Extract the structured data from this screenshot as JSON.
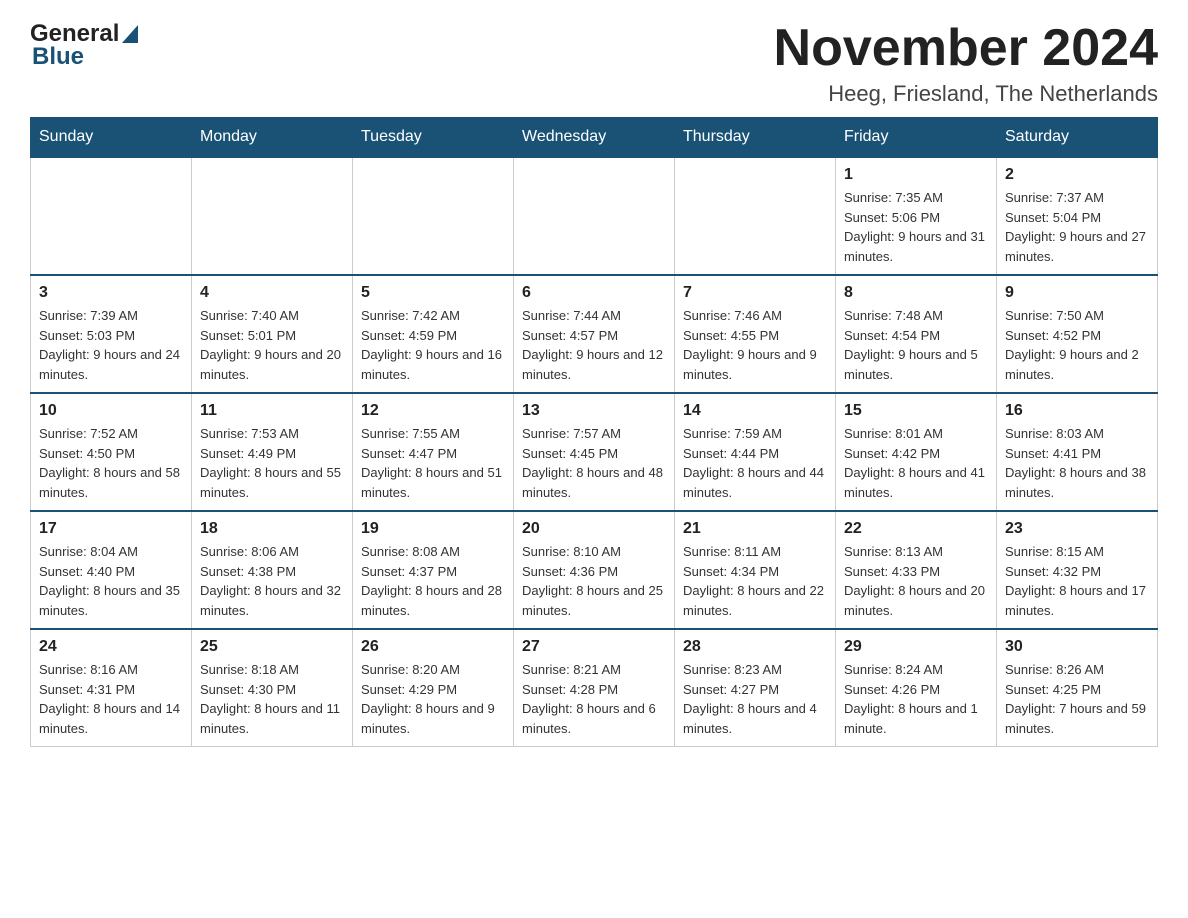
{
  "header": {
    "logo": {
      "part1": "General",
      "part2": "Blue"
    },
    "title": "November 2024",
    "subtitle": "Heeg, Friesland, The Netherlands"
  },
  "days_of_week": [
    "Sunday",
    "Monday",
    "Tuesday",
    "Wednesday",
    "Thursday",
    "Friday",
    "Saturday"
  ],
  "weeks": [
    {
      "days": [
        {
          "number": "",
          "info": ""
        },
        {
          "number": "",
          "info": ""
        },
        {
          "number": "",
          "info": ""
        },
        {
          "number": "",
          "info": ""
        },
        {
          "number": "",
          "info": ""
        },
        {
          "number": "1",
          "info": "Sunrise: 7:35 AM\nSunset: 5:06 PM\nDaylight: 9 hours and 31 minutes."
        },
        {
          "number": "2",
          "info": "Sunrise: 7:37 AM\nSunset: 5:04 PM\nDaylight: 9 hours and 27 minutes."
        }
      ]
    },
    {
      "days": [
        {
          "number": "3",
          "info": "Sunrise: 7:39 AM\nSunset: 5:03 PM\nDaylight: 9 hours and 24 minutes."
        },
        {
          "number": "4",
          "info": "Sunrise: 7:40 AM\nSunset: 5:01 PM\nDaylight: 9 hours and 20 minutes."
        },
        {
          "number": "5",
          "info": "Sunrise: 7:42 AM\nSunset: 4:59 PM\nDaylight: 9 hours and 16 minutes."
        },
        {
          "number": "6",
          "info": "Sunrise: 7:44 AM\nSunset: 4:57 PM\nDaylight: 9 hours and 12 minutes."
        },
        {
          "number": "7",
          "info": "Sunrise: 7:46 AM\nSunset: 4:55 PM\nDaylight: 9 hours and 9 minutes."
        },
        {
          "number": "8",
          "info": "Sunrise: 7:48 AM\nSunset: 4:54 PM\nDaylight: 9 hours and 5 minutes."
        },
        {
          "number": "9",
          "info": "Sunrise: 7:50 AM\nSunset: 4:52 PM\nDaylight: 9 hours and 2 minutes."
        }
      ]
    },
    {
      "days": [
        {
          "number": "10",
          "info": "Sunrise: 7:52 AM\nSunset: 4:50 PM\nDaylight: 8 hours and 58 minutes."
        },
        {
          "number": "11",
          "info": "Sunrise: 7:53 AM\nSunset: 4:49 PM\nDaylight: 8 hours and 55 minutes."
        },
        {
          "number": "12",
          "info": "Sunrise: 7:55 AM\nSunset: 4:47 PM\nDaylight: 8 hours and 51 minutes."
        },
        {
          "number": "13",
          "info": "Sunrise: 7:57 AM\nSunset: 4:45 PM\nDaylight: 8 hours and 48 minutes."
        },
        {
          "number": "14",
          "info": "Sunrise: 7:59 AM\nSunset: 4:44 PM\nDaylight: 8 hours and 44 minutes."
        },
        {
          "number": "15",
          "info": "Sunrise: 8:01 AM\nSunset: 4:42 PM\nDaylight: 8 hours and 41 minutes."
        },
        {
          "number": "16",
          "info": "Sunrise: 8:03 AM\nSunset: 4:41 PM\nDaylight: 8 hours and 38 minutes."
        }
      ]
    },
    {
      "days": [
        {
          "number": "17",
          "info": "Sunrise: 8:04 AM\nSunset: 4:40 PM\nDaylight: 8 hours and 35 minutes."
        },
        {
          "number": "18",
          "info": "Sunrise: 8:06 AM\nSunset: 4:38 PM\nDaylight: 8 hours and 32 minutes."
        },
        {
          "number": "19",
          "info": "Sunrise: 8:08 AM\nSunset: 4:37 PM\nDaylight: 8 hours and 28 minutes."
        },
        {
          "number": "20",
          "info": "Sunrise: 8:10 AM\nSunset: 4:36 PM\nDaylight: 8 hours and 25 minutes."
        },
        {
          "number": "21",
          "info": "Sunrise: 8:11 AM\nSunset: 4:34 PM\nDaylight: 8 hours and 22 minutes."
        },
        {
          "number": "22",
          "info": "Sunrise: 8:13 AM\nSunset: 4:33 PM\nDaylight: 8 hours and 20 minutes."
        },
        {
          "number": "23",
          "info": "Sunrise: 8:15 AM\nSunset: 4:32 PM\nDaylight: 8 hours and 17 minutes."
        }
      ]
    },
    {
      "days": [
        {
          "number": "24",
          "info": "Sunrise: 8:16 AM\nSunset: 4:31 PM\nDaylight: 8 hours and 14 minutes."
        },
        {
          "number": "25",
          "info": "Sunrise: 8:18 AM\nSunset: 4:30 PM\nDaylight: 8 hours and 11 minutes."
        },
        {
          "number": "26",
          "info": "Sunrise: 8:20 AM\nSunset: 4:29 PM\nDaylight: 8 hours and 9 minutes."
        },
        {
          "number": "27",
          "info": "Sunrise: 8:21 AM\nSunset: 4:28 PM\nDaylight: 8 hours and 6 minutes."
        },
        {
          "number": "28",
          "info": "Sunrise: 8:23 AM\nSunset: 4:27 PM\nDaylight: 8 hours and 4 minutes."
        },
        {
          "number": "29",
          "info": "Sunrise: 8:24 AM\nSunset: 4:26 PM\nDaylight: 8 hours and 1 minute."
        },
        {
          "number": "30",
          "info": "Sunrise: 8:26 AM\nSunset: 4:25 PM\nDaylight: 7 hours and 59 minutes."
        }
      ]
    }
  ]
}
